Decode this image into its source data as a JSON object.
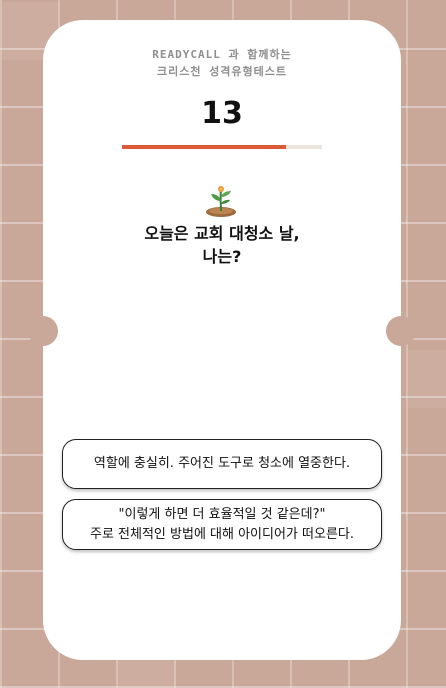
{
  "header": {
    "brand_line1": "READYCALL 과 함께하는",
    "brand_line2": "크리스천 성격유형테스트"
  },
  "quiz": {
    "question_number": "13",
    "progress": 0.82,
    "question_line1": "오늘은 교회 대청소 날,",
    "question_line2": "나는?",
    "icon": "sprout-icon"
  },
  "answers": [
    {
      "line1": "역할에 충실히. 주어진 도구로 청소에 열중한다.",
      "line2": ""
    },
    {
      "line1": "\"이렇게 하면 더 효율적일 것 같은데?\"",
      "line2": "주로 전체적인 방법에 대해 아이디어가 떠오른다."
    }
  ],
  "colors": {
    "background": "#c9a899",
    "card": "#ffffff",
    "progress_fill": "#d95a35",
    "progress_track": "#ebe4dc",
    "brand_text": "#8f8f8f"
  }
}
